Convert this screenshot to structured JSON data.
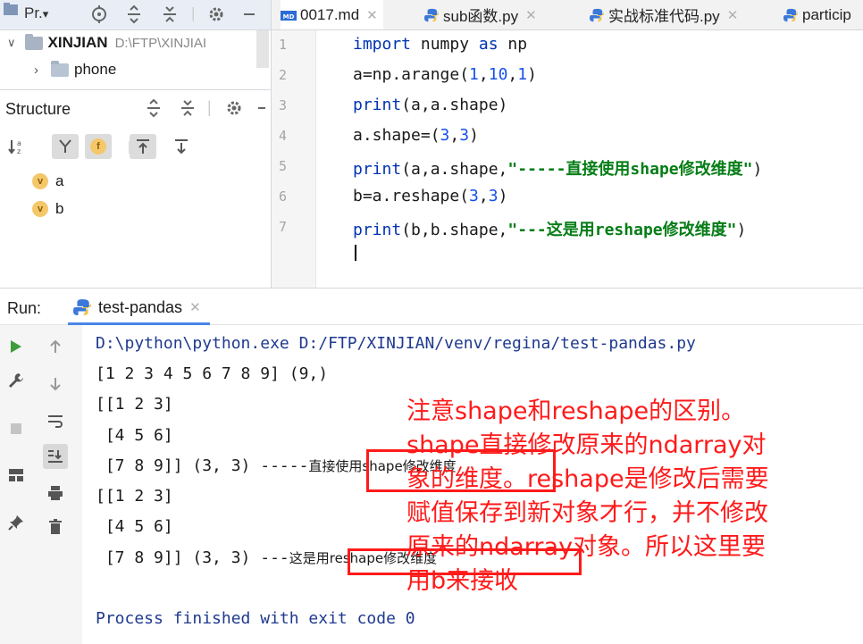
{
  "project_toolbar": {
    "project_label": "Pr.",
    "dropdown_glyph": "▾"
  },
  "tabs": [
    {
      "label": "0017.md",
      "icon": "markdown-icon",
      "active": true
    },
    {
      "label": "sub函数.py",
      "icon": "python-icon",
      "active": false
    },
    {
      "label": "实战标准代码.py",
      "icon": "python-icon",
      "active": false
    },
    {
      "label": "particip",
      "icon": "python-icon",
      "active": false
    }
  ],
  "project_tree": {
    "root_name": "XINJIAN",
    "root_path": "D:\\FTP\\XINJIAI",
    "child": "phone"
  },
  "structure": {
    "title": "Structure",
    "variables": [
      "a",
      "b"
    ],
    "variable_badge": "v"
  },
  "editor": {
    "line_numbers": [
      "1",
      "2",
      "3",
      "4",
      "5",
      "6",
      "7"
    ],
    "lines": {
      "l1_import": "import",
      "l1_mod": " numpy ",
      "l1_as": "as",
      "l1_alias": " np",
      "l2_a": "a=np.arange(",
      "l2_n1": "1",
      "l2_c1": ",",
      "l2_n2": "10",
      "l2_c2": ",",
      "l2_n3": "1",
      "l2_end": ")",
      "l3_print": "print",
      "l3_rest": "(a,a.shape)",
      "l4_a": "a.shape=(",
      "l4_n1": "3",
      "l4_c": ",",
      "l4_n2": "3",
      "l4_end": ")",
      "l5_print": "print",
      "l5_mid": "(a,a.shape,",
      "l5_str": "\"-----直接使用shape修改维度\"",
      "l5_end": ")",
      "l6_a": "b=a.reshape(",
      "l6_n1": "3",
      "l6_c": ",",
      "l6_n2": "3",
      "l6_end": ")",
      "l7_print": "print",
      "l7_mid": "(b,b.shape,",
      "l7_str": "\"---这是用reshape修改维度\"",
      "l7_end": ")"
    }
  },
  "run": {
    "label": "Run:",
    "tab_label": "test-pandas"
  },
  "console": {
    "path": "D:\\python\\python.exe D:/FTP/XINJIAN/venv/regina/test-pandas.py",
    "out1": "[1 2 3 4 5 6 7 8 9] (9,)",
    "out2": "[[1 2 3]",
    "out3": " [4 5 6]",
    "out4_a": " [7 8 9]] (3, 3) -----",
    "out4_b": "直接使用shape修改维度",
    "out5": "[[1 2 3]",
    "out6": " [4 5 6]",
    "out7_a": " [7 8 9]] (3, 3) ---",
    "out7_b": "这是用reshape修改维度",
    "exit": "Process finished with exit code 0"
  },
  "annotation": {
    "line1": "注意shape和reshape的区别。",
    "line2": "shape直接修改原来的ndarray对",
    "line3": "象的维度。reshape是修改后需要",
    "line4": "赋值保存到新对象才行，并不修改",
    "line5": "原来的ndarray对象。所以这里要",
    "line6": "用b来接收",
    "color": "#ff1a1a"
  }
}
